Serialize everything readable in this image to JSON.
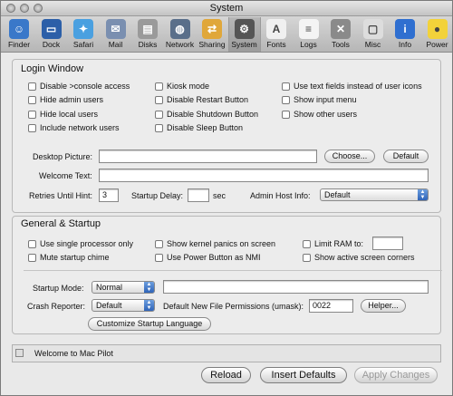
{
  "window": {
    "title": "System"
  },
  "toolbar": {
    "items": [
      {
        "label": "Finder",
        "icon": "finder-icon",
        "color": "#3a78c9"
      },
      {
        "label": "Dock",
        "icon": "dock-icon",
        "color": "#2c5fa8"
      },
      {
        "label": "Safari",
        "icon": "safari-icon",
        "color": "#4aa0e0"
      },
      {
        "label": "Mail",
        "icon": "mail-icon",
        "color": "#7a8fb0"
      },
      {
        "label": "Disks",
        "icon": "disks-icon",
        "color": "#9a9a9a"
      },
      {
        "label": "Network",
        "icon": "network-icon",
        "color": "#5a6f8a"
      },
      {
        "label": "Sharing",
        "icon": "sharing-icon",
        "color": "#e0a73a"
      },
      {
        "label": "System",
        "icon": "system-icon",
        "color": "#555555"
      },
      {
        "label": "Fonts",
        "icon": "fonts-icon",
        "color": "#f0f0f0"
      },
      {
        "label": "Logs",
        "icon": "logs-icon",
        "color": "#f4f4f4"
      },
      {
        "label": "Tools",
        "icon": "tools-icon",
        "color": "#8a8a8a"
      },
      {
        "label": "Misc",
        "icon": "misc-icon",
        "color": "#dddddd"
      },
      {
        "label": "Info",
        "icon": "info-icon",
        "color": "#2f6fd0"
      },
      {
        "label": "Power",
        "icon": "power-icon",
        "color": "#f2d23a"
      }
    ],
    "active": "System"
  },
  "login": {
    "title": "Login Window",
    "checkboxes": [
      "Disable >console access",
      "Hide admin users",
      "Hide local users",
      "Include network users",
      "Kiosk mode",
      "Disable Restart Button",
      "Disable Shutdown Button",
      "Disable Sleep Button",
      "Use text fields instead of user icons",
      "Show input menu",
      "Show other users"
    ],
    "desktop_label": "Desktop Picture:",
    "desktop_value": "",
    "choose_label": "Choose...",
    "default_label": "Default",
    "welcome_label": "Welcome Text:",
    "welcome_value": "",
    "retries_label": "Retries Until Hint:",
    "retries_value": "3",
    "startup_delay_label": "Startup Delay:",
    "startup_delay_value": "",
    "sec_label": "sec",
    "admin_host_label": "Admin Host Info:",
    "admin_host_value": "Default"
  },
  "general": {
    "title": "General & Startup",
    "checkboxes": [
      "Use single processor only",
      "Mute startup chime",
      "Show kernel panics on screen",
      "Use Power Button as NMI",
      "Limit RAM to:",
      "Show active screen corners"
    ],
    "ram_value": "",
    "startup_mode_label": "Startup Mode:",
    "startup_mode_value": "Normal",
    "startup_mode_text": "",
    "crash_label": "Crash Reporter:",
    "crash_value": "Default",
    "umask_label": "Default New File Permissions (umask):",
    "umask_value": "0022",
    "helper_label": "Helper...",
    "customize_label": "Customize Startup Language"
  },
  "status": {
    "text": "Welcome to Mac Pilot"
  },
  "buttons": {
    "reload": "Reload",
    "insert_defaults": "Insert Defaults",
    "apply": "Apply Changes"
  }
}
